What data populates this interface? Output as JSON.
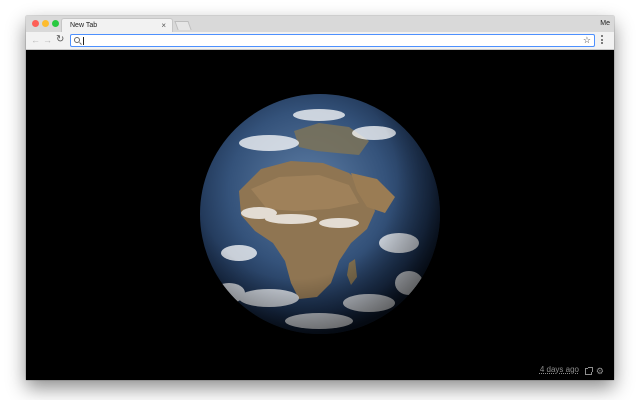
{
  "browser": {
    "tab": {
      "title": "New Tab",
      "close_glyph": "×"
    },
    "profile_label": "Me",
    "toolbar": {
      "back_glyph": "←",
      "forward_glyph": "→",
      "reload_glyph": "↻",
      "address_value": "",
      "bookmark_glyph": "☆"
    }
  },
  "page": {
    "image_subject": "earth-globe",
    "timestamp": "4 days ago",
    "settings_glyph": "⚙",
    "background_color": "#000000"
  },
  "icons": [
    "search-icon",
    "star-icon",
    "menu-icon",
    "external-link-icon",
    "gear-icon"
  ]
}
